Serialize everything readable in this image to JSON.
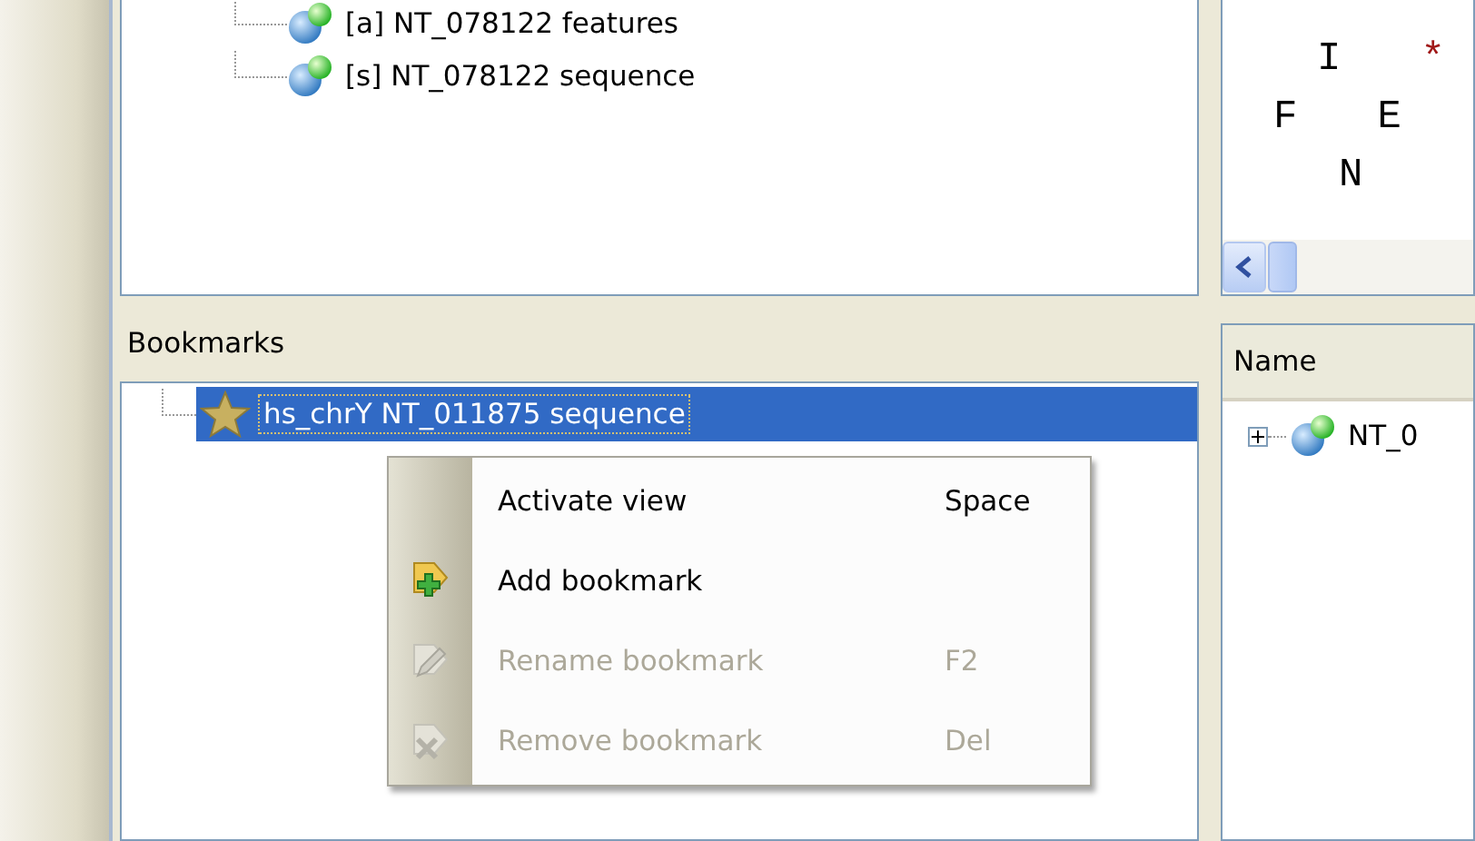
{
  "object_tree": {
    "items": [
      {
        "label": "[a] NT_078122 features"
      },
      {
        "label": "[s] NT_078122 sequence"
      }
    ]
  },
  "sequence_view": {
    "rows": [
      [
        {
          "text": "I"
        },
        {
          "text": "*",
          "color": "#a01818"
        }
      ],
      [
        {
          "text": "F"
        },
        {
          "text": "E"
        }
      ],
      [
        {
          "text": "N"
        }
      ]
    ]
  },
  "bookmarks": {
    "title": "Bookmarks",
    "items": [
      {
        "label": "hs_chrY NT_011875 sequence",
        "selected": true
      }
    ]
  },
  "name_panel": {
    "header": "Name",
    "items": [
      {
        "label": "NT_0",
        "expanded": false
      }
    ]
  },
  "context_menu": {
    "items": [
      {
        "label": "Activate view",
        "shortcut": "Space",
        "disabled": false
      },
      {
        "label": "Add bookmark",
        "disabled": false
      },
      {
        "label": "Rename bookmark",
        "shortcut": "F2",
        "disabled": true
      },
      {
        "label": "Remove bookmark",
        "shortcut": "Del",
        "disabled": true
      }
    ]
  }
}
